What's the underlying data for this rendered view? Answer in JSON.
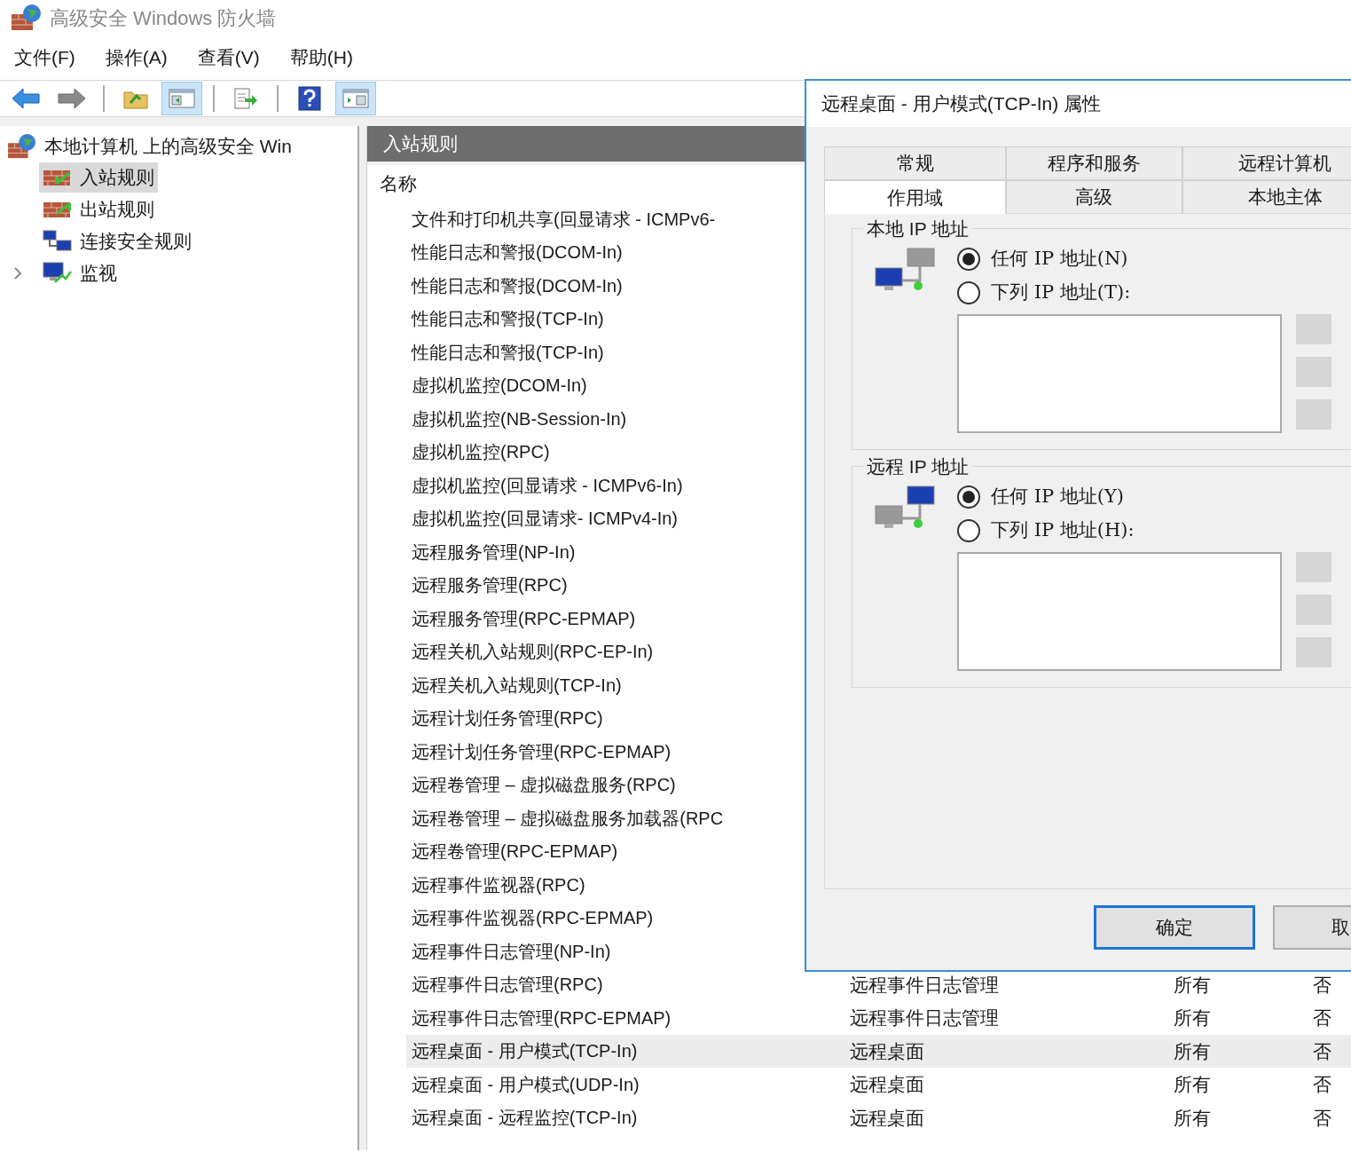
{
  "window": {
    "title": "高级安全 Windows 防火墙"
  },
  "menu": [
    "文件(F)",
    "操作(A)",
    "查看(V)",
    "帮助(H)"
  ],
  "toolbar": [
    {
      "kind": "back",
      "pressed": false
    },
    {
      "kind": "forward",
      "pressed": false
    },
    {
      "kind": "sep"
    },
    {
      "kind": "up",
      "pressed": false
    },
    {
      "kind": "tree",
      "pressed": true
    },
    {
      "kind": "sep"
    },
    {
      "kind": "export",
      "pressed": false
    },
    {
      "kind": "sep"
    },
    {
      "kind": "help",
      "pressed": false
    },
    {
      "kind": "pane",
      "pressed": true
    }
  ],
  "tree": {
    "label": "本地计算机 上的高级安全 Win",
    "children": [
      {
        "label": "入站规则",
        "kind": "inbound",
        "selected": true
      },
      {
        "label": "出站规则",
        "kind": "outbound",
        "selected": false
      },
      {
        "label": "连接安全规则",
        "kind": "security",
        "selected": false
      },
      {
        "label": "监视",
        "kind": "monitor",
        "selected": false,
        "expanded": false
      }
    ]
  },
  "panel": {
    "title": "入站规则",
    "columns": [
      "名称"
    ],
    "rows": [
      {
        "name": "文件和打印机共享(回显请求 - ICMPv6-",
        "selected": false
      },
      {
        "name": "性能日志和警报(DCOM-In)",
        "selected": false
      },
      {
        "name": "性能日志和警报(DCOM-In)",
        "selected": false
      },
      {
        "name": "性能日志和警报(TCP-In)",
        "selected": false
      },
      {
        "name": "性能日志和警报(TCP-In)",
        "selected": false
      },
      {
        "name": "虚拟机监控(DCOM-In)",
        "selected": false
      },
      {
        "name": "虚拟机监控(NB-Session-In)",
        "selected": false
      },
      {
        "name": "虚拟机监控(RPC)",
        "selected": false
      },
      {
        "name": "虚拟机监控(回显请求 - ICMPv6-In)",
        "selected": false
      },
      {
        "name": "虚拟机监控(回显请求- ICMPv4-In)",
        "selected": false
      },
      {
        "name": "远程服务管理(NP-In)",
        "selected": false
      },
      {
        "name": "远程服务管理(RPC)",
        "selected": false
      },
      {
        "name": "远程服务管理(RPC-EPMAP)",
        "selected": false
      },
      {
        "name": "远程关机入站规则(RPC-EP-In)",
        "selected": false
      },
      {
        "name": "远程关机入站规则(TCP-In)",
        "selected": false
      },
      {
        "name": "远程计划任务管理(RPC)",
        "selected": false
      },
      {
        "name": "远程计划任务管理(RPC-EPMAP)",
        "selected": false
      },
      {
        "name": "远程卷管理 – 虚拟磁盘服务(RPC)",
        "selected": false
      },
      {
        "name": "远程卷管理 – 虚拟磁盘服务加载器(RPC",
        "selected": false
      },
      {
        "name": "远程卷管理(RPC-EPMAP)",
        "selected": false
      },
      {
        "name": "远程事件监视器(RPC)",
        "selected": false
      },
      {
        "name": "远程事件监视器(RPC-EPMAP)",
        "selected": false
      },
      {
        "name": "远程事件日志管理(NP-In)",
        "selected": false
      },
      {
        "name": "远程事件日志管理(RPC)",
        "group": "远程事件日志管理",
        "profile": "所有",
        "enabled": "否",
        "selected": false
      },
      {
        "name": "远程事件日志管理(RPC-EPMAP)",
        "group": "远程事件日志管理",
        "profile": "所有",
        "enabled": "否",
        "selected": false
      },
      {
        "name": "远程桌面 - 用户模式(TCP-In)",
        "group": "远程桌面",
        "profile": "所有",
        "enabled": "否",
        "selected": true
      },
      {
        "name": "远程桌面 - 用户模式(UDP-In)",
        "group": "远程桌面",
        "profile": "所有",
        "enabled": "否",
        "selected": false
      },
      {
        "name": "远程桌面 - 远程监控(TCP-In)",
        "group": "远程桌面",
        "profile": "所有",
        "enabled": "否",
        "selected": false
      }
    ]
  },
  "dialog": {
    "title": "远程桌面 - 用户模式(TCP-In) 属性",
    "tab_rows": [
      [
        {
          "label": "常规",
          "selected": false
        },
        {
          "label": "程序和服务",
          "selected": false
        },
        {
          "label": "远程计算机",
          "selected": false
        }
      ],
      [
        {
          "label": "作用域",
          "selected": true
        },
        {
          "label": "高级",
          "selected": false
        },
        {
          "label": "本地主体",
          "selected": false
        }
      ]
    ],
    "groups": [
      {
        "title": "本地 IP 地址",
        "kind": "local",
        "options": [
          {
            "label": "任何 IP 地址(N)",
            "selected": true
          },
          {
            "label": "下列 IP 地址(T):",
            "selected": false
          }
        ]
      },
      {
        "title": "远程 IP 地址",
        "kind": "remote",
        "options": [
          {
            "label": "任何 IP 地址(Y)",
            "selected": true
          },
          {
            "label": "下列 IP 地址(H):",
            "selected": false
          }
        ]
      }
    ],
    "buttons": [
      {
        "label": "确定",
        "default": true
      },
      {
        "label": "取",
        "default": false
      }
    ]
  }
}
